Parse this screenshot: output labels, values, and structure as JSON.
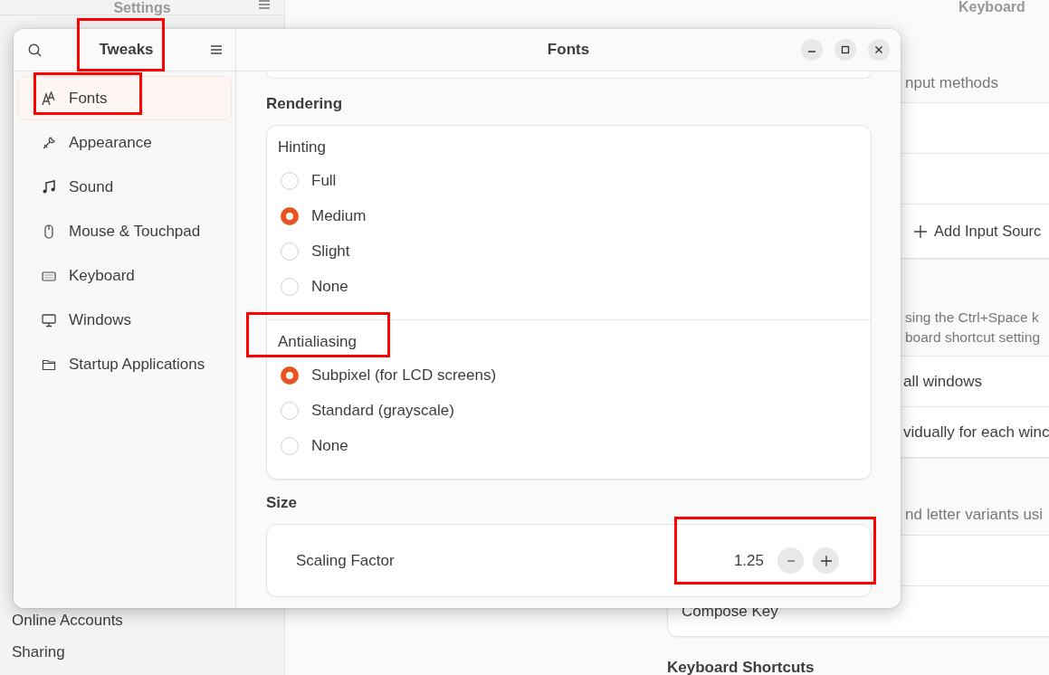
{
  "background_window": {
    "title": "Settings",
    "sidebar_items": [
      {
        "label": "Online Accounts"
      },
      {
        "label": "Sharing"
      }
    ],
    "page_title": "Keyboard",
    "input_sources": {
      "caption": "nput methods",
      "add_button": "Add Input Sourc"
    },
    "switching": {
      "caption_lines": [
        "sing the Ctrl+Space k",
        "board shortcut setting"
      ],
      "options": [
        "all windows",
        "vidually for each winc"
      ]
    },
    "special_entry": {
      "caption": "nd letter variants usi",
      "compose_key": "Compose Key"
    },
    "section_heading": "Keyboard Shortcuts"
  },
  "window": {
    "title": "Tweaks",
    "content_title": "Fonts"
  },
  "sidebar": {
    "items": [
      {
        "label": "Fonts",
        "selected": true
      },
      {
        "label": "Appearance",
        "selected": false
      },
      {
        "label": "Sound",
        "selected": false
      },
      {
        "label": "Mouse & Touchpad",
        "selected": false
      },
      {
        "label": "Keyboard",
        "selected": false
      },
      {
        "label": "Windows",
        "selected": false
      },
      {
        "label": "Startup Applications",
        "selected": false
      }
    ]
  },
  "rendering": {
    "heading": "Rendering",
    "groups": [
      {
        "label": "Hinting",
        "options": [
          {
            "label": "Full",
            "selected": false
          },
          {
            "label": "Medium",
            "selected": true
          },
          {
            "label": "Slight",
            "selected": false
          },
          {
            "label": "None",
            "selected": false
          }
        ]
      },
      {
        "label": "Antialiasing",
        "options": [
          {
            "label": "Subpixel (for LCD screens)",
            "selected": true
          },
          {
            "label": "Standard (grayscale)",
            "selected": false
          },
          {
            "label": "None",
            "selected": false
          }
        ]
      }
    ]
  },
  "size": {
    "heading": "Size",
    "scaling_factor": {
      "label": "Scaling Factor",
      "value": "1.25"
    }
  }
}
